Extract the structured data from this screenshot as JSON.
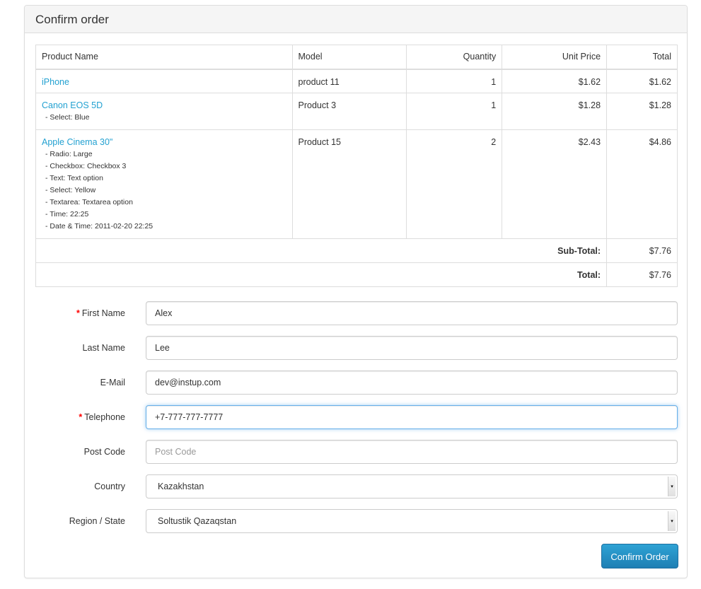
{
  "panel": {
    "title": "Confirm order"
  },
  "cart": {
    "headers": [
      "Product Name",
      "Model",
      "Quantity",
      "Unit Price",
      "Total"
    ],
    "rows": [
      {
        "name": "iPhone",
        "model": "product 11",
        "quantity": "1",
        "unit_price": "$1.62",
        "total": "$1.62",
        "options": []
      },
      {
        "name": "Canon EOS 5D",
        "model": "Product 3",
        "quantity": "1",
        "unit_price": "$1.28",
        "total": "$1.28",
        "options": [
          "- Select: Blue"
        ]
      },
      {
        "name": "Apple Cinema 30\"",
        "model": "Product 15",
        "quantity": "2",
        "unit_price": "$2.43",
        "total": "$4.86",
        "options": [
          "- Radio: Large",
          "- Checkbox: Checkbox 3",
          "- Text: Text option",
          "- Select: Yellow",
          "- Textarea: Textarea option",
          "- Time: 22:25",
          "- Date & Time: 2011-02-20 22:25"
        ]
      }
    ],
    "totals": [
      {
        "label": "Sub-Total:",
        "value": "$7.76"
      },
      {
        "label": "Total:",
        "value": "$7.76"
      }
    ]
  },
  "form": {
    "first_name": {
      "label": "First Name",
      "value": "Alex",
      "required_mark": "*"
    },
    "last_name": {
      "label": "Last Name",
      "value": "Lee"
    },
    "email": {
      "label": "E-Mail",
      "value": "dev@instup.com"
    },
    "telephone": {
      "label": "Telephone",
      "value": "+7-777-777-7777",
      "required_mark": "*"
    },
    "post_code": {
      "label": "Post Code",
      "value": "",
      "placeholder": "Post Code"
    },
    "country": {
      "label": "Country",
      "value": "Kazakhstan"
    },
    "region": {
      "label": "Region / State",
      "value": "Soltustik Qazaqstan"
    }
  },
  "actions": {
    "confirm_label": "Confirm Order"
  },
  "colors": {
    "link": "#23a1d1",
    "required": "#ff0000",
    "button": "#2490c6",
    "focus_border": "#66afe9"
  }
}
